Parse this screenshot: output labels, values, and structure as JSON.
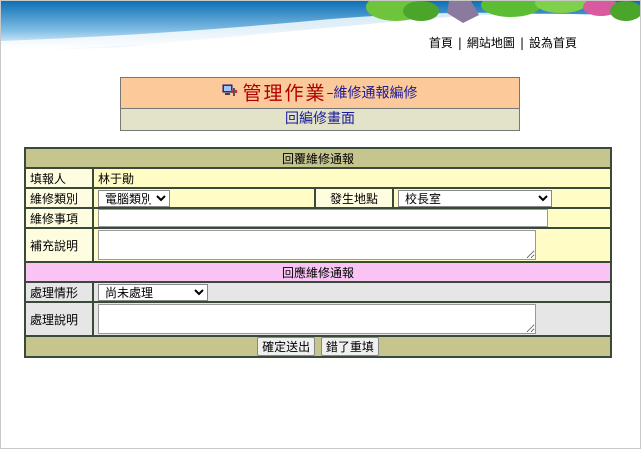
{
  "topnav": {
    "home": "首頁",
    "sitemap": "網站地圖",
    "set_home": "設為首頁",
    "sep": "|"
  },
  "title": {
    "main": "管理作業",
    "dash": "–",
    "sub": "維修通報編修"
  },
  "back_link": "回編修畫面",
  "form": {
    "reply_header": "回覆維修通報",
    "reporter_label": "填報人",
    "reporter_value": "林于勛",
    "category_label": "維修類別",
    "category_value": "電腦類別",
    "location_label": "發生地點",
    "location_value": "校長室",
    "item_label": "維修事項",
    "item_value": "",
    "note_label": "補充說明",
    "note_value": "",
    "response_header": "回應維修通報",
    "status_label": "處理情形",
    "status_value": "尚未處理",
    "process_label": "處理說明",
    "process_value": "",
    "submit_label": "確定送出",
    "reset_label": "錯了重填"
  },
  "colors": {
    "title_bg": "#fcc99b",
    "header_bg": "#c7c58e",
    "pink_bg": "#f9c4f4",
    "label_bg": "#fffde0",
    "title_red": "#b00000",
    "link_blue": "#1a1a9c"
  }
}
